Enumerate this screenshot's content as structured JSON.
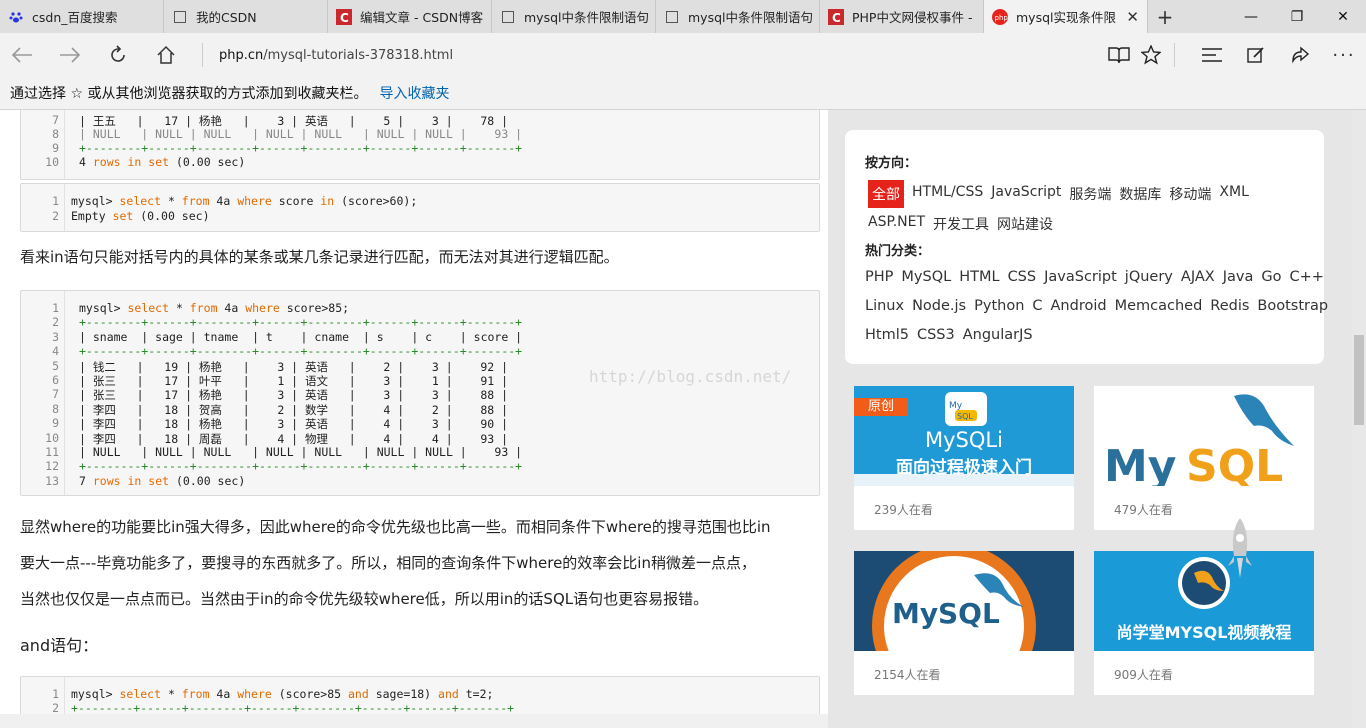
{
  "tabs": [
    {
      "label": "csdn_百度搜索",
      "icon": "baidu-paw-icon"
    },
    {
      "label": "我的CSDN",
      "icon": "page-icon"
    },
    {
      "label": "编辑文章 - CSDN博客",
      "icon": "csdn-icon"
    },
    {
      "label": "mysql中条件限制语句",
      "icon": "page-icon"
    },
    {
      "label": "mysql中条件限制语句",
      "icon": "page-icon"
    },
    {
      "label": "PHP中文网侵权事件 -",
      "icon": "csdn-icon"
    },
    {
      "label": "mysql实现条件限",
      "icon": "php-icon",
      "active": true
    }
  ],
  "address": {
    "host": "php.cn",
    "path": "/mysql-tutorials-378318.html"
  },
  "favbar": {
    "text": "通过选择 ☆ 或从其他浏览器获取的方式添加到收藏夹栏。",
    "link": "导入收藏夹"
  },
  "code1": {
    "lines": [
      {
        "n": "7",
        "t": "| 王五   |   17 | 杨艳   |    3 | 英语   |    5 |    3 |    78 |"
      },
      {
        "n": "8",
        "t": "| NULL   | NULL | NULL   | NULL | NULL   | NULL | NULL |    93 |"
      },
      {
        "n": "9",
        "t": "+--------+------+--------+------+--------+------+------+-------+"
      },
      {
        "n": "10",
        "t": "4 rows in set (0.00 sec)"
      }
    ]
  },
  "code2": {
    "lines": [
      {
        "n": "1",
        "t": "mysql> select * from 4a where score in (score>60);"
      },
      {
        "n": "2",
        "t": "Empty set (0.00 sec)"
      }
    ]
  },
  "para1": "看来in语句只能对括号内的具体的某条或某几条记录进行匹配，而无法对其进行逻辑匹配。",
  "code3": {
    "lines": [
      {
        "n": "1",
        "t": "mysql> select * from 4a where score>85;"
      },
      {
        "n": "2",
        "t": "+--------+------+--------+------+--------+------+------+-------+"
      },
      {
        "n": "3",
        "t": "| sname  | sage | tname  | t    | cname  | s    | c    | score |"
      },
      {
        "n": "4",
        "t": "+--------+------+--------+------+--------+------+------+-------+"
      },
      {
        "n": "5",
        "t": "| 钱二   |   19 | 杨艳   |    3 | 英语   |    2 |    3 |    92 |"
      },
      {
        "n": "6",
        "t": "| 张三   |   17 | 叶平   |    1 | 语文   |    3 |    1 |    91 |"
      },
      {
        "n": "7",
        "t": "| 张三   |   17 | 杨艳   |    3 | 英语   |    3 |    3 |    88 |"
      },
      {
        "n": "8",
        "t": "| 李四   |   18 | 贺高   |    2 | 数学   |    4 |    2 |    88 |"
      },
      {
        "n": "9",
        "t": "| 李四   |   18 | 杨艳   |    3 | 英语   |    4 |    3 |    90 |"
      },
      {
        "n": "10",
        "t": "| 李四   |   18 | 周磊   |    4 | 物理   |    4 |    4 |    93 |"
      },
      {
        "n": "11",
        "t": "| NULL   | NULL | NULL   | NULL | NULL   | NULL | NULL |    93 |"
      },
      {
        "n": "12",
        "t": "+--------+------+--------+------+--------+------+------+-------+"
      },
      {
        "n": "13",
        "t": "7 rows in set (0.00 sec)"
      }
    ]
  },
  "watermark": "http://blog.csdn.net/",
  "para2": [
    "显然where的功能要比in强大得多，因此where的命令优先级也比高一些。而相同条件下where的搜寻范围也比in",
    "要大一点---毕竟功能多了，要搜寻的东西就多了。所以，相同的查询条件下where的效率会比in稍微差一点点，",
    "当然也仅仅是一点点而已。当然由于in的命令优先级较where低，所以用in的话SQL语句也更容易报错。"
  ],
  "heading_and": "and语句：",
  "code4": {
    "lines": [
      {
        "n": "1",
        "t": "mysql> select * from 4a where (score>85 and sage=18) and t=2;"
      },
      {
        "n": "2",
        "t": "+--------+------+--------+------+--------+------+------+-------+"
      }
    ]
  },
  "sidebar": {
    "direction_title": "按方向：",
    "direction_items": [
      "全部",
      "HTML/CSS",
      "JavaScript",
      "服务端",
      "数据库",
      "移动端",
      "XML"
    ],
    "direction_items2": [
      "ASP.NET",
      "开发工具",
      "网站建设"
    ],
    "hot_title": "热门分类：",
    "hot_row1": [
      "PHP",
      "MySQL",
      "HTML",
      "CSS",
      "JavaScript",
      "jQuery",
      "AJAX",
      "Java",
      "Go",
      "C++"
    ],
    "hot_row2": [
      "Linux",
      "Node.js",
      "Python",
      "C",
      "Android",
      "Memcached",
      "Redis",
      "Bootstrap"
    ],
    "hot_row3": [
      "Html5",
      "CSS3",
      "AngularJS"
    ]
  },
  "courses": [
    {
      "badge": "原创",
      "title1": "MySQLi",
      "title2": "面向过程极速入门",
      "views": "239人在看"
    },
    {
      "logo": "MySQL",
      "views": "479人在看"
    },
    {
      "logo": "MySQL",
      "views": "2154人在看"
    },
    {
      "title": "尚学堂MYSQL视频教程",
      "views": "909人在看"
    }
  ],
  "colors": {
    "accent_red": "#e5231b",
    "link_blue": "#0063b1",
    "keyword_orange": "#e26a00"
  }
}
